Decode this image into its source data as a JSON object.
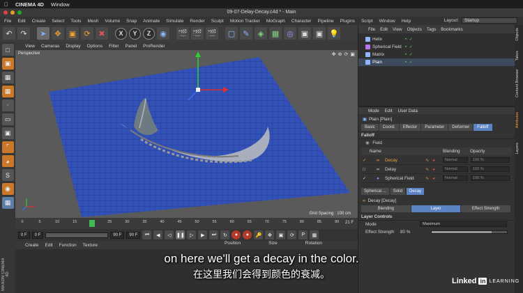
{
  "mac_menu": {
    "app": "CINEMA 4D",
    "window": "Window"
  },
  "window_title": "09-07-Delay-Decay.c4d * - Main",
  "app_menu": [
    "File",
    "Edit",
    "Create",
    "Select",
    "Tools",
    "Mesh",
    "Volume",
    "Snap",
    "Animate",
    "Simulate",
    "Render",
    "Sculpt",
    "Motion Tracker",
    "MoGraph",
    "Character",
    "Pipeline",
    "Plugins",
    "Script",
    "Window",
    "Help"
  ],
  "layout": {
    "label": "Layout:",
    "value": "Startup"
  },
  "toolbar": {
    "axis_x": "X",
    "axis_y": "Y",
    "axis_z": "Z"
  },
  "viewport": {
    "menu": [
      "View",
      "Cameras",
      "Display",
      "Options",
      "Filter",
      "Panel",
      "ProRender"
    ],
    "label": "Perspective",
    "grid_spacing": "Grid Spacing : 100 cm"
  },
  "timeline": {
    "ticks": [
      "0",
      "5",
      "10",
      "15",
      "20",
      "25",
      "30",
      "35",
      "40",
      "45",
      "50",
      "55",
      "60",
      "65",
      "70",
      "75",
      "80",
      "85",
      "90"
    ],
    "current_frame": 20,
    "end_label": "21 F"
  },
  "transport": {
    "start": "0 F",
    "min": "0 F",
    "max": "90 F",
    "end": "90 F"
  },
  "bottom_menu": [
    "Create",
    "Edit",
    "Function",
    "Texture"
  ],
  "coord_headers": [
    "Position",
    "Size",
    "Rotation"
  ],
  "objects_panel": {
    "menu": [
      "File",
      "Edit",
      "View",
      "Objects",
      "Tags",
      "Bookmarks"
    ],
    "items": [
      {
        "name": "Helix",
        "color": "#8fb6ff"
      },
      {
        "name": "Spherical Field",
        "color": "#b874e8"
      },
      {
        "name": "Matrix",
        "color": "#8fb6ff"
      },
      {
        "name": "Plain",
        "color": "#8fb6ff"
      }
    ]
  },
  "attributes": {
    "menu": [
      "Mode",
      "Edit",
      "User Data"
    ],
    "title": "Plain [Plain]",
    "tabs": [
      "Basic",
      "Coord.",
      "Effector",
      "Parameter",
      "Deformer",
      "Falloff"
    ],
    "active_tab": "Falloff",
    "section_falloff": "Falloff",
    "field_label": "Field",
    "columns": {
      "name": "Name",
      "blending": "Blending",
      "opacity": "Opacity"
    },
    "fields": [
      {
        "name": "Decay",
        "blending": "Normal",
        "opacity": "100 %"
      },
      {
        "name": "Delay",
        "blending": "Normal",
        "opacity": "100 %"
      },
      {
        "name": "Spherical Field",
        "blending": "Normal",
        "opacity": "100 %"
      }
    ],
    "sub_tabs": [
      "Spherical ...",
      "Solid",
      "Decay"
    ],
    "decay_title": "Decay [Decay]",
    "decay_tabs": [
      "Blending",
      "Layer",
      "Effect Strength"
    ],
    "active_decay_tab": "Layer",
    "layer_controls": "Layer Controls",
    "mode_label": "Mode",
    "mode_value": "Maximum",
    "strength_label": "Effect Strength",
    "strength_value": "80 %"
  },
  "side_tabs": [
    "Objects",
    "Takes",
    "Content Browser",
    "Attributes",
    "Layers"
  ],
  "subtitles": {
    "en": "on here we'll get a decay in the color.",
    "zh": "在这里我们会得到颜色的衰减。"
  },
  "brand": {
    "linked": "Linked",
    "in": "in",
    "learning": "LEARNING"
  },
  "maxon": "MAXON CINEMA 4D"
}
